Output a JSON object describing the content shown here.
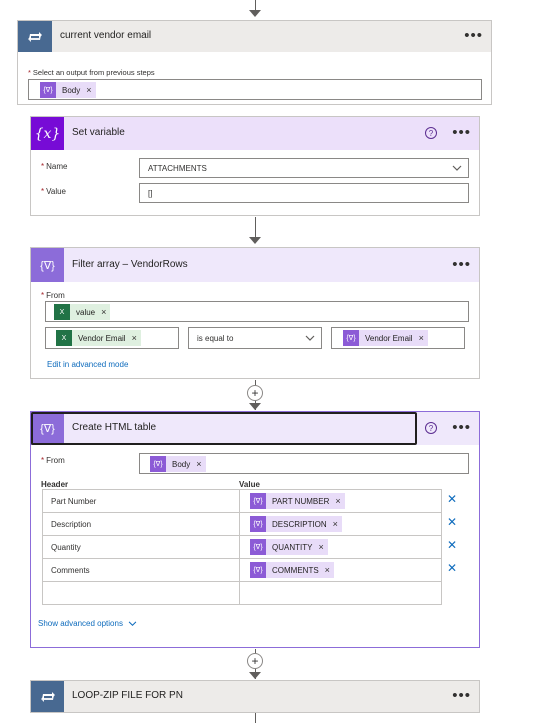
{
  "loop_card": {
    "title": "current vendor email",
    "output_label": "Select an output from previous steps",
    "output_token": "Body",
    "more": "•••"
  },
  "set_variable": {
    "title": "Set variable",
    "icon_text": "{x}",
    "name_label": "Name",
    "name_value": "ATTACHMENTS",
    "value_label": "Value",
    "value_value": "[]",
    "help": "?",
    "more": "•••"
  },
  "filter_array": {
    "title": "Filter array – VendorRows",
    "from_label": "From",
    "from_token": "value",
    "left_token": "Vendor Email",
    "operator": "is equal to",
    "right_token": "Vendor Email",
    "advanced_link": "Edit in advanced mode",
    "more": "•••"
  },
  "html_table": {
    "title": "Create HTML table",
    "from_label": "From",
    "from_token": "Body",
    "header_col": "Header",
    "value_col": "Value",
    "rows": [
      {
        "header": "Part Number",
        "value": "PART NUMBER"
      },
      {
        "header": "Description",
        "value": "DESCRIPTION"
      },
      {
        "header": "Quantity",
        "value": "QUANTITY"
      },
      {
        "header": "Comments",
        "value": "COMMENTS"
      }
    ],
    "advanced_options": "Show advanced options",
    "help": "?",
    "more": "•••"
  },
  "loop_zip": {
    "title": "LOOP-ZIP FILE FOR PN",
    "more": "•••"
  },
  "glyphs": {
    "remove": "×",
    "delete": "✕",
    "plus": "+",
    "chevron": "⌵",
    "expr": "{∇}",
    "excel": "X"
  },
  "colors": {
    "loop_header": "#edebe9",
    "loop_icon": "#486991",
    "variable_header": "#ece0fa",
    "variable_icon": "#770bd6",
    "data_op_header": "#efe8fb",
    "data_op_icon": "#8c6cd9",
    "link": "#0f6cbd"
  }
}
